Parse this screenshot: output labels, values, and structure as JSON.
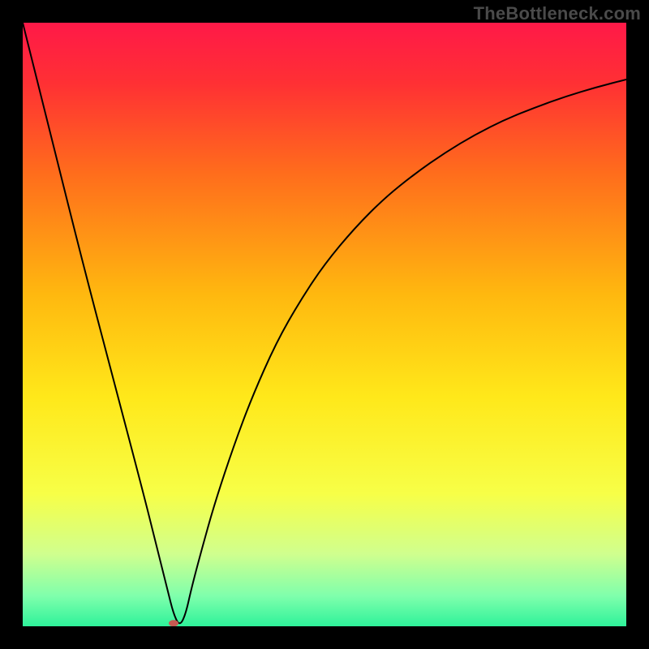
{
  "watermark": "TheBottleneck.com",
  "chart_data": {
    "type": "line",
    "title": "",
    "xlabel": "",
    "ylabel": "",
    "xlim": [
      0,
      100
    ],
    "ylim": [
      0,
      100
    ],
    "background_gradient": {
      "stops": [
        {
          "offset": 0.0,
          "color": "#ff1948"
        },
        {
          "offset": 0.1,
          "color": "#ff3034"
        },
        {
          "offset": 0.25,
          "color": "#ff6d1c"
        },
        {
          "offset": 0.45,
          "color": "#ffb80f"
        },
        {
          "offset": 0.62,
          "color": "#ffe81a"
        },
        {
          "offset": 0.78,
          "color": "#f7ff47"
        },
        {
          "offset": 0.88,
          "color": "#d0ff8e"
        },
        {
          "offset": 0.95,
          "color": "#7fffac"
        },
        {
          "offset": 1.0,
          "color": "#2ef29a"
        }
      ]
    },
    "series": [
      {
        "name": "bottleneck-curve",
        "color": "#000000",
        "stroke_width": 2,
        "x": [
          0,
          5,
          10,
          15,
          20,
          22,
          24,
          25,
          26,
          27,
          28,
          30,
          32,
          35,
          38,
          42,
          46,
          50,
          55,
          60,
          65,
          70,
          75,
          80,
          85,
          90,
          95,
          100
        ],
        "y": [
          100,
          80,
          60,
          41,
          22,
          14,
          6,
          2,
          0,
          2,
          6.5,
          14,
          21,
          30,
          38,
          47,
          54,
          60,
          66,
          71,
          75,
          78.5,
          81.5,
          84,
          86,
          87.8,
          89.3,
          90.6
        ]
      }
    ],
    "marker": {
      "name": "optimal-point",
      "x": 25,
      "y": 0.5,
      "rx": 6,
      "ry": 4,
      "color": "#c65a52"
    },
    "frame": {
      "outer_size": 800,
      "inner_margin": 28,
      "border_color": "#000000"
    }
  }
}
